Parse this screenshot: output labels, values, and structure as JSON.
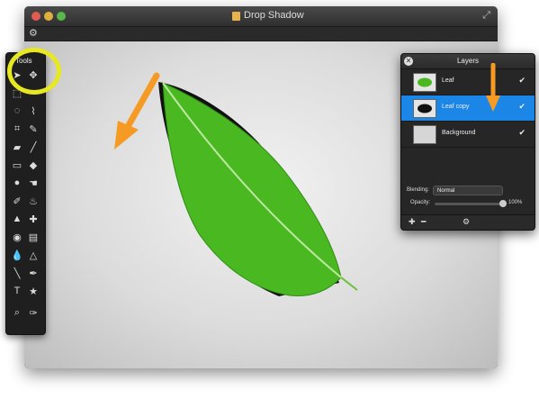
{
  "window": {
    "title": "Drop Shadow",
    "settings_icon": "gear-icon"
  },
  "tools_panel": {
    "title": "Tools",
    "tools": [
      "move",
      "marquee",
      "lasso",
      "magnetic-lasso",
      "crop",
      "pen",
      "eraser",
      "brush",
      "gradient",
      "fill",
      "blob",
      "smudge",
      "dodge",
      "burn",
      "stamp",
      "heal",
      "eye",
      "sponge",
      "drop",
      "sharpen",
      "line",
      "dropper",
      "text",
      "shape",
      "zoom",
      "color-picker"
    ]
  },
  "layers_panel": {
    "title": "Layers",
    "layers": [
      {
        "name": "Leaf",
        "visible": true,
        "selected": false
      },
      {
        "name": "Leaf copy",
        "visible": true,
        "selected": true
      },
      {
        "name": "Background",
        "visible": true,
        "selected": false
      }
    ],
    "blending_label": "Blending:",
    "blending_value": "Normal",
    "opacity_label": "Opacity:",
    "opacity_value": "100%",
    "opacity_fraction": 1.0
  },
  "colors": {
    "accent": "#1c86e6",
    "highlight": "#e8e820",
    "arrow": "#f59a23",
    "leaf": "#46b81e"
  }
}
